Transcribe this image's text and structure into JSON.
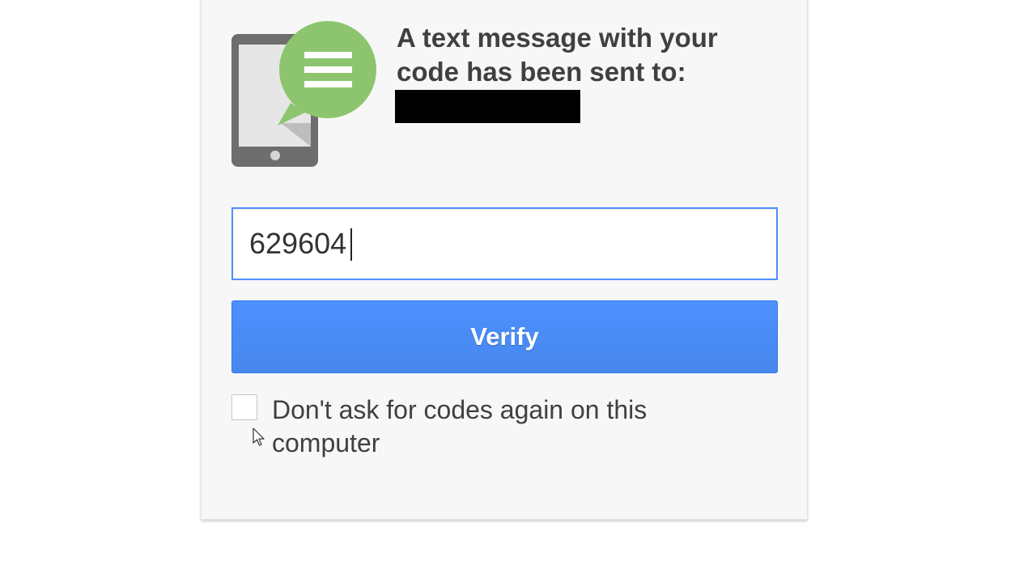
{
  "verification": {
    "heading": "A text message with your code has been sent to:",
    "phone_number_redacted": true,
    "code_input": {
      "value": "629604",
      "focused": true
    },
    "verify_button_label": "Verify",
    "remember_checkbox": {
      "label": "Don't ask for codes again on this computer",
      "checked": false
    }
  },
  "icons": {
    "illustration": "phone-with-message-bubble-icon",
    "pointer": "mouse-pointer-icon"
  },
  "colors": {
    "accent": "#4d90fe",
    "bubble": "#8cc56e",
    "phone_body": "#6b6b6b",
    "text": "#404040"
  }
}
